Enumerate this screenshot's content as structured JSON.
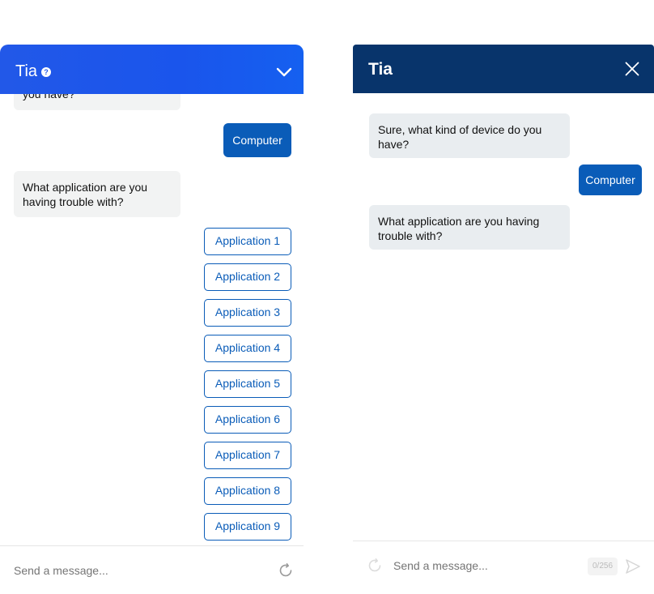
{
  "left": {
    "title": "Tia",
    "help_icon": "?",
    "icons": {
      "help": "question-circle-icon",
      "collapse": "chevron-down-icon",
      "refresh": "refresh-icon"
    },
    "bot_message_partial": "you have?",
    "user_reply": "Computer",
    "bot_message": "What application are you having trouble with?",
    "options": [
      "Application 1",
      "Application 2",
      "Application 3",
      "Application 4",
      "Application 5",
      "Application 6",
      "Application 7",
      "Application 8",
      "Application 9"
    ],
    "input_placeholder": "Send a message..."
  },
  "right": {
    "title": "Tia",
    "icons": {
      "close": "close-icon",
      "refresh": "refresh-icon",
      "send": "send-icon"
    },
    "bot_message_1": "Sure, what kind of device do you have?",
    "user_reply": "Computer",
    "bot_message_2": "What application are you having trouble with?",
    "input_placeholder": "Send a message...",
    "char_counter": "0/256"
  },
  "colors": {
    "left_header": "#2258e8",
    "right_header": "#08346b",
    "accent": "#0a5cb8",
    "bot_bubble_left": "#f2f3f3",
    "bot_bubble_right": "#e9edf0"
  }
}
